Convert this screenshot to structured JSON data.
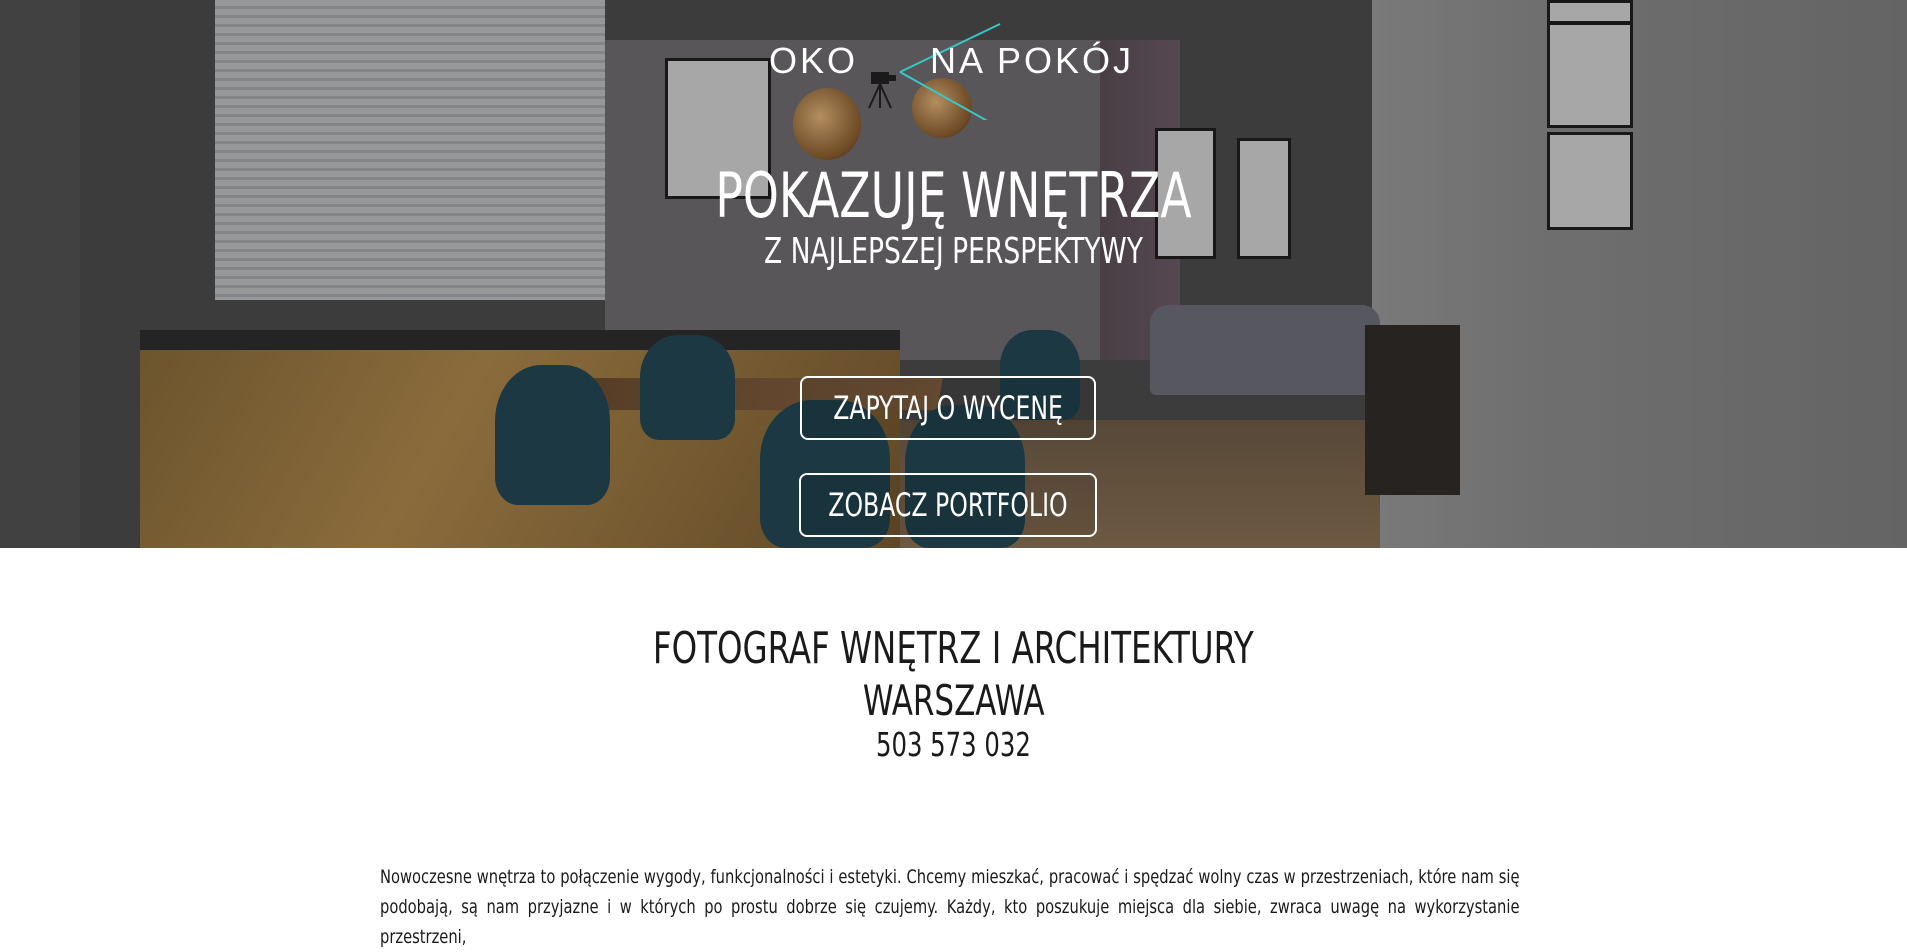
{
  "logo": {
    "left_word": "OKO",
    "right_word": "NA POKÓJ",
    "accent_color": "#38c6c6",
    "icon": "camera-on-tripod-icon"
  },
  "hero": {
    "title": "POKAZUJĘ WNĘTRZA",
    "subtitle": "Z NAJLEPSZEJ PERSPEKTYWY",
    "quote_button": "ZAPYTAJ O WYCENĘ",
    "portfolio_button": "ZOBACZ PORTFOLIO"
  },
  "section": {
    "title": "FOTOGRAF WNĘTRZ I ARCHITEKTURY",
    "city": "WARSZAWA",
    "phone": "503 573 032",
    "intro": "Nowoczesne wnętrza to połączenie wygody, funkcjonalności i estetyki. Chcemy mieszkać, pracować i spędzać wolny czas w przestrzeniach, które nam się podobają, są nam przyjazne i w których po prostu dobrze się czujemy. Każdy, kto poszukuje miejsca dla siebie, zwraca uwagę na wykorzystanie przestrzeni,"
  },
  "colors": {
    "text_dark": "#1a1a1a",
    "hero_text": "#ffffff"
  }
}
